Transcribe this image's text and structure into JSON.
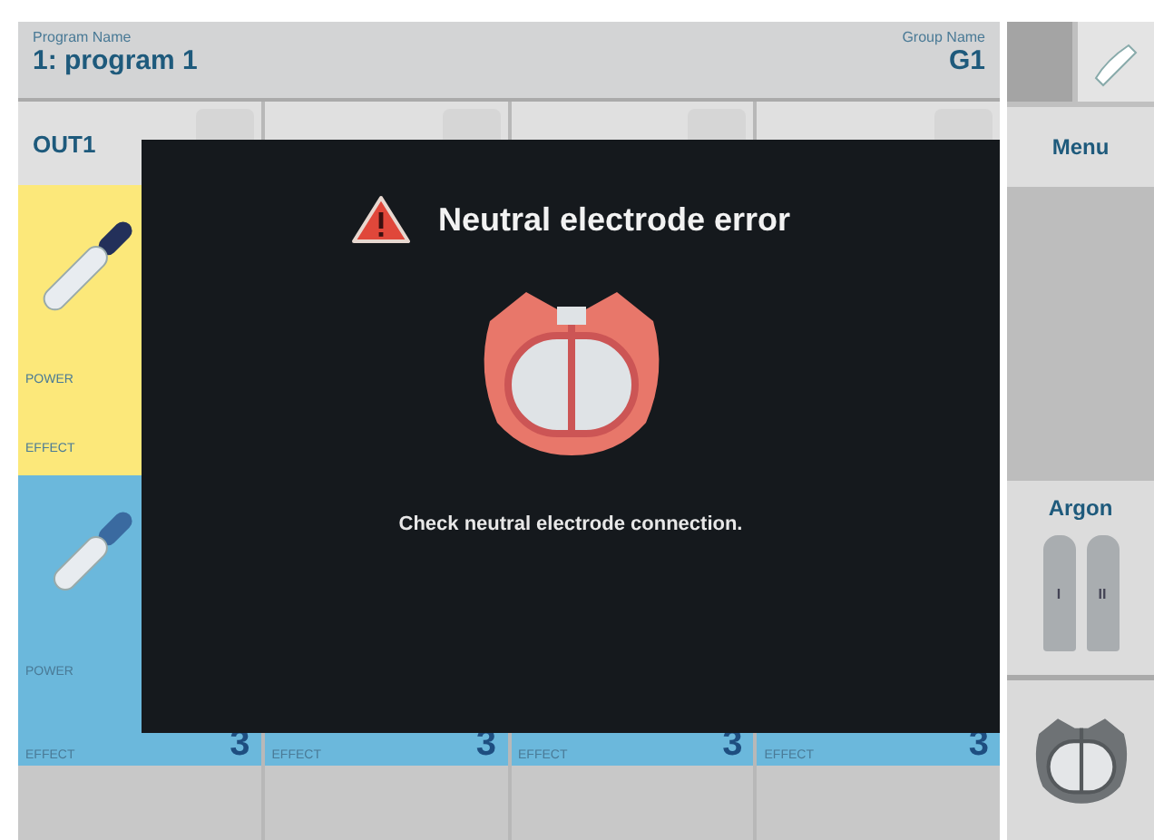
{
  "header": {
    "program_label": "Program Name",
    "program": "1: program 1",
    "group_label": "Group Name",
    "group": "G1"
  },
  "out_tab": {
    "label": "OUT1"
  },
  "upper_row": {
    "power_label": "POWER",
    "effect_label": "EFFECT"
  },
  "lower_row": {
    "power_label": "POWER",
    "effects": [
      {
        "label": "EFFECT",
        "value": "3"
      },
      {
        "label": "EFFECT",
        "value": "3"
      },
      {
        "label": "EFFECT",
        "value": "3"
      },
      {
        "label": "EFFECT",
        "value": "3"
      }
    ]
  },
  "side": {
    "menu": "Menu",
    "argon_title": "Argon",
    "bottles": [
      "I",
      "II"
    ]
  },
  "dialog": {
    "title": "Neutral electrode error",
    "message": "Check neutral electrode connection."
  }
}
